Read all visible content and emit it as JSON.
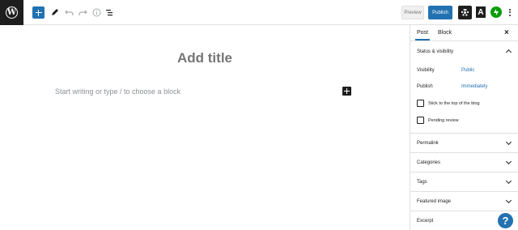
{
  "toolbar": {
    "preview_label": "Preview",
    "publish_label": "Publish",
    "a_label": "A",
    "icons": [
      "wordpress-logo-icon",
      "plus-icon",
      "pencil-icon",
      "undo-icon",
      "redo-icon",
      "info-icon",
      "list-view-icon",
      "gear-icon",
      "jetpack-icon",
      "more-vertical-icon"
    ],
    "accent": "#2271b1"
  },
  "editor": {
    "title_placeholder": "Add title",
    "body_placeholder": "Start writing or type / to choose a block"
  },
  "sidebar": {
    "tabs": [
      {
        "label": "Post"
      },
      {
        "label": "Block"
      }
    ],
    "close_label": "×",
    "status": {
      "title": "Status & visibility",
      "visibility_label": "Visibility",
      "visibility_value": "Public",
      "publish_label": "Publish",
      "publish_value": "Immediately",
      "sticky_label": "Stick to the top of the blog",
      "pending_label": "Pending review"
    },
    "panels": [
      {
        "title": "Permalink"
      },
      {
        "title": "Categories"
      },
      {
        "title": "Tags"
      },
      {
        "title": "Featured image"
      },
      {
        "title": "Excerpt"
      }
    ]
  },
  "help_label": "?"
}
